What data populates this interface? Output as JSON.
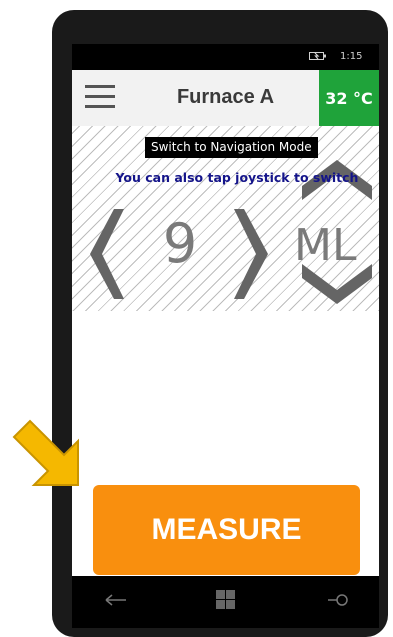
{
  "status_bar": {
    "time": "1:15",
    "battery_icon": "battery-charging-icon"
  },
  "header": {
    "menu_icon": "hamburger-menu-icon",
    "title": "Furnace A",
    "temperature": "32 °C",
    "temperature_color": "#1fa33a"
  },
  "navigation": {
    "switch_label": "Switch to Navigation Mode",
    "hint": "You can also tap joystick to switch",
    "digit_value": "9",
    "unit_value": "ML"
  },
  "action": {
    "measure_label": "MEASURE",
    "color": "#f98f0e"
  },
  "bottom_nav": {
    "back_icon": "back-arrow-icon",
    "home_icon": "windows-icon",
    "search_icon": "search-icon"
  },
  "annotation": {
    "pointer_icon": "arrow-pointer-icon",
    "color": "#f5b800"
  }
}
